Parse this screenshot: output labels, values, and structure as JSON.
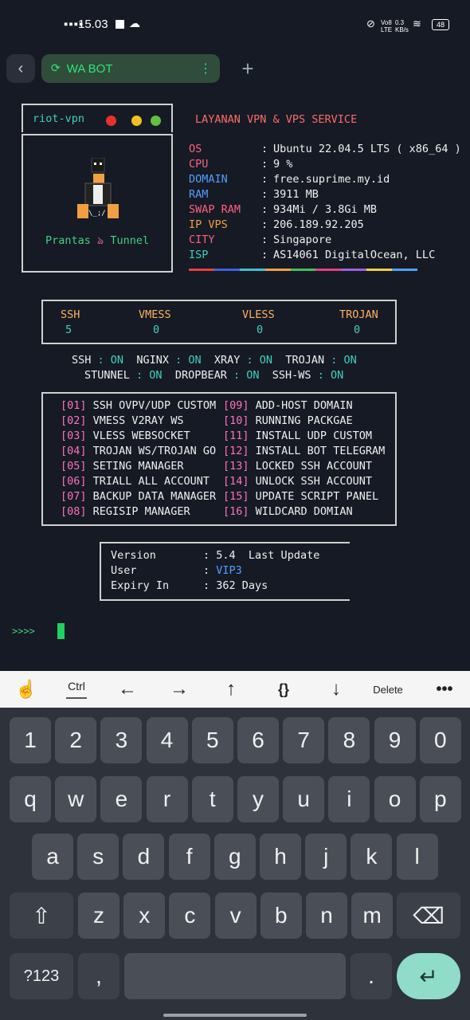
{
  "status_bar": {
    "time": "15.03",
    "network": "Vo8 LTE",
    "speed": "0.3 KB/s",
    "battery": "48"
  },
  "tab": {
    "title": "WA BOT"
  },
  "header": {
    "app_name": "riot-vpn",
    "service": "LAYANAN VPN & VPS SERVICE",
    "brand": "Prantas",
    "brand_symbol": "ঌ",
    "brand_suffix": "Tunnel"
  },
  "sysinfo": [
    {
      "key": "OS",
      "value": "Ubuntu 22.04.5 LTS ( x86_64 )"
    },
    {
      "key": "CPU",
      "value": "9 %"
    },
    {
      "key": "DOMAIN",
      "value": "free.suprime.my.id"
    },
    {
      "key": "RAM",
      "value": "3911 MB"
    },
    {
      "key": "SWAP RAM",
      "value": "934Mi / 3.8Gi MB"
    },
    {
      "key": "IP VPS",
      "value": "206.189.92.205"
    },
    {
      "key": "CITY",
      "value": "Singapore"
    },
    {
      "key": "ISP",
      "value": "AS14061 DigitalOcean, LLC"
    }
  ],
  "accounts": [
    {
      "name": "SSH",
      "count": "5"
    },
    {
      "name": "VMESS",
      "count": "0"
    },
    {
      "name": "VLESS",
      "count": "0"
    },
    {
      "name": "TROJAN",
      "count": "0"
    }
  ],
  "services_row1": [
    {
      "name": "SSH",
      "state": "ON"
    },
    {
      "name": "NGINX",
      "state": "ON"
    },
    {
      "name": "XRAY",
      "state": "ON"
    },
    {
      "name": "TROJAN",
      "state": "ON"
    }
  ],
  "services_row2": [
    {
      "name": "STUNNEL",
      "state": "ON"
    },
    {
      "name": "DROPBEAR",
      "state": "ON"
    },
    {
      "name": "SSH-WS",
      "state": "ON"
    }
  ],
  "menu_left": [
    {
      "num": "[01]",
      "label": "SSH OVPV/UDP CUSTOM"
    },
    {
      "num": "[02]",
      "label": "VMESS V2RAY WS"
    },
    {
      "num": "[03]",
      "label": "VLESS WEBSOCKET"
    },
    {
      "num": "[04]",
      "label": "TROJAN WS/TROJAN GO"
    },
    {
      "num": "[05]",
      "label": "SETING MANAGER"
    },
    {
      "num": "[06]",
      "label": "TRIALL ALL ACCOUNT"
    },
    {
      "num": "[07]",
      "label": "BACKUP DATA MANAGER"
    },
    {
      "num": "[08]",
      "label": "REGISIP MANAGER"
    }
  ],
  "menu_right": [
    {
      "num": "[09]",
      "label": "ADD-HOST DOMAIN"
    },
    {
      "num": "[10]",
      "label": "RUNNING PACKGAE"
    },
    {
      "num": "[11]",
      "label": "INSTALL UDP CUSTOM"
    },
    {
      "num": "[12]",
      "label": "INSTALL BOT TELEGRAM"
    },
    {
      "num": "[13]",
      "label": "LOCKED SSH ACCOUNT"
    },
    {
      "num": "[14]",
      "label": "UNLOCK SSH ACCOUNT"
    },
    {
      "num": "[15]",
      "label": "UPDATE SCRIPT PANEL"
    },
    {
      "num": "[16]",
      "label": "WILDCARD DOMIAN"
    }
  ],
  "version_info": {
    "version_label": "Version",
    "version_value": "5.4",
    "last_update": "Last Update",
    "user_label": "User",
    "user_value": "VIP3",
    "expiry_label": "Expiry In",
    "expiry_value": "362 Days"
  },
  "prompt": ">>>>",
  "toolbar": {
    "ctrl": "Ctrl",
    "delete": "Delete",
    "braces": "{}"
  },
  "keyboard": {
    "row_numbers": [
      "1",
      "2",
      "3",
      "4",
      "5",
      "6",
      "7",
      "8",
      "9",
      "0"
    ],
    "row1": [
      "q",
      "w",
      "e",
      "r",
      "t",
      "y",
      "u",
      "i",
      "o",
      "p"
    ],
    "row2": [
      "a",
      "s",
      "d",
      "f",
      "g",
      "h",
      "j",
      "k",
      "l"
    ],
    "row3": [
      "z",
      "x",
      "c",
      "v",
      "b",
      "n",
      "m"
    ],
    "symbols": "?123",
    "comma": ",",
    "period": "."
  }
}
